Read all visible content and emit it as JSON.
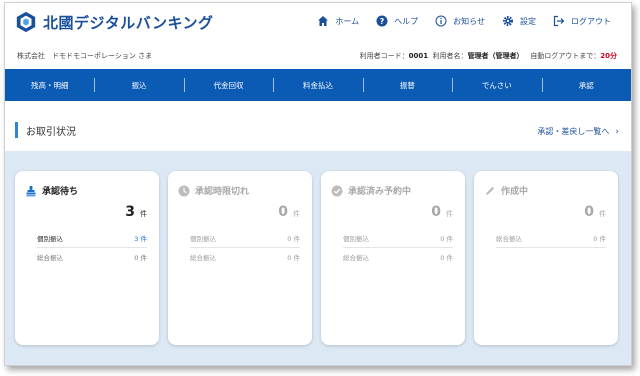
{
  "header": {
    "logo_text": "北國デジタルバンキング",
    "nav": [
      {
        "label": "ホーム",
        "icon": "home-icon"
      },
      {
        "label": "ヘルプ",
        "icon": "help-icon"
      },
      {
        "label": "お知らせ",
        "icon": "info-icon"
      },
      {
        "label": "設定",
        "icon": "gear-icon"
      },
      {
        "label": "ログアウト",
        "icon": "logout-icon"
      }
    ],
    "company": "株式会社　ドモドモコーポレーション さま",
    "user_code_label": "利用者コード：",
    "user_code": "0001",
    "user_name_label": "利用者名：",
    "user_name": "管理者（管理者）",
    "auto_logout_label": "自動ログアウトまで：",
    "auto_logout_value": "20分"
  },
  "main_nav": [
    "残高・明細",
    "振込",
    "代金回収",
    "料金払込",
    "振替",
    "でんさい",
    "承認"
  ],
  "section": {
    "title": "お取引状況",
    "link": "承認・差戻し一覧へ"
  },
  "cards": [
    {
      "title": "承認待ち",
      "icon": "stamp-icon",
      "count": "3",
      "unit": "件",
      "rows": [
        {
          "label": "個別振込",
          "value": "3 件"
        },
        {
          "label": "総合振込",
          "value": "0 件"
        }
      ]
    },
    {
      "title": "承認時限切れ",
      "icon": "clock-icon",
      "count": "0",
      "unit": "件",
      "rows": [
        {
          "label": "個別振込",
          "value": "0 件"
        },
        {
          "label": "総合振込",
          "value": "0 件"
        }
      ]
    },
    {
      "title": "承認済み予約中",
      "icon": "check-circle-icon",
      "count": "0",
      "unit": "件",
      "rows": [
        {
          "label": "個別振込",
          "value": "0 件"
        },
        {
          "label": "総合振込",
          "value": "0 件"
        }
      ]
    },
    {
      "title": "作成中",
      "icon": "pencil-icon",
      "count": "0",
      "unit": "件",
      "rows": [
        {
          "label": "総合振込",
          "value": "0 件"
        }
      ]
    }
  ],
  "colors": {
    "brand": "#1a4f9c",
    "nav_bg": "#0b5bb5",
    "panel_bg": "#dce9f5",
    "accent_blue": "#1a6fcf",
    "warning_red": "#d0021b"
  }
}
